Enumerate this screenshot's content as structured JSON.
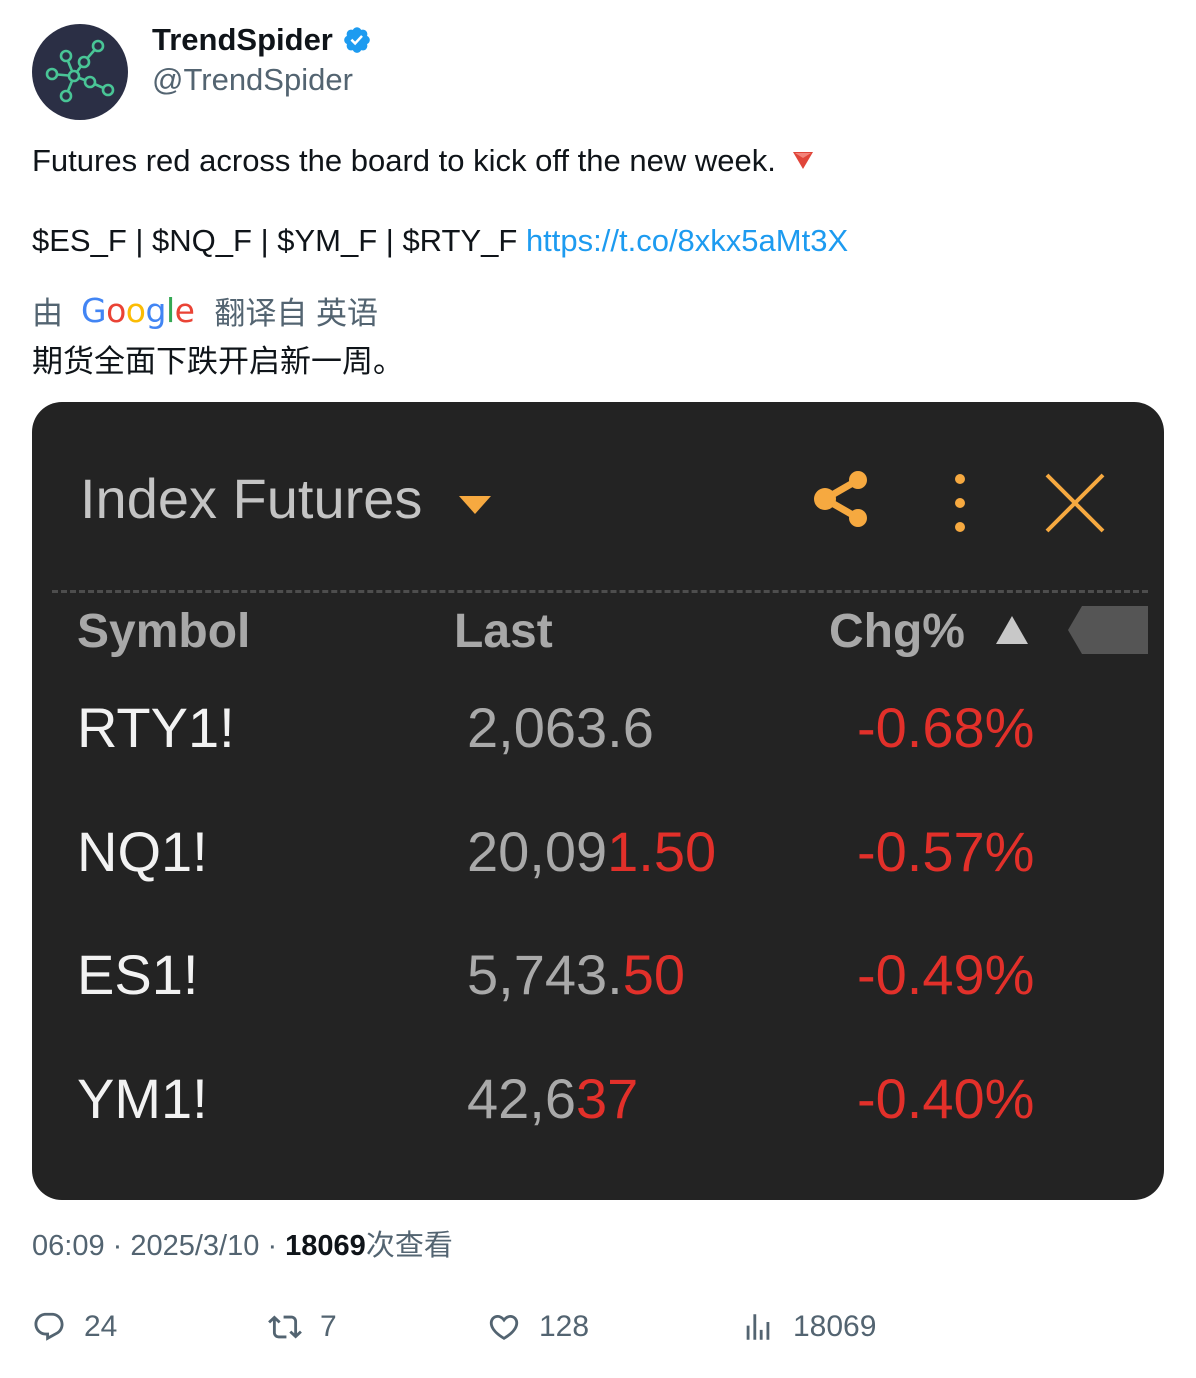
{
  "author": {
    "display_name": "TrendSpider",
    "handle": "@TrendSpider",
    "verified": true,
    "avatar_icon": "trendspider-logo-icon"
  },
  "tweet": {
    "text_line1": "Futures red across the board to kick off the new week.",
    "emoji": "red-triangle-down",
    "cashtags": "$ES_F | $NQ_F | $YM_F | $RTY_F",
    "link": "https://t.co/8xkx5aMt3X",
    "translate": {
      "by": "由",
      "google": [
        "G",
        "o",
        "o",
        "g",
        "l",
        "e"
      ],
      "from": "翻译自 英语"
    },
    "translation": "期货全面下跌开启新一周。"
  },
  "widget": {
    "title": "Index Futures",
    "columns": {
      "symbol": "Symbol",
      "last": "Last",
      "chg": "Chg%"
    },
    "rows": [
      {
        "symbol": "RTY1!",
        "last_plain": "2,063.6",
        "last_red": "",
        "chg": "-0.68%"
      },
      {
        "symbol": "NQ1!",
        "last_plain": "20,09",
        "last_red": "1.50",
        "chg": "-0.57%"
      },
      {
        "symbol": "ES1!",
        "last_plain": "5,743.",
        "last_red": "50",
        "chg": "-0.49%"
      },
      {
        "symbol": "YM1!",
        "last_plain": "42,6",
        "last_red": "37",
        "chg": "-0.40%"
      }
    ],
    "colors": {
      "background": "#232323",
      "accent": "#f6a940",
      "negative": "#e2302a"
    }
  },
  "meta": {
    "time": "06:09",
    "date": "2025/3/10",
    "views": "18069",
    "views_label": "次查看"
  },
  "actions": {
    "replies": "24",
    "retweets": "7",
    "likes": "128",
    "views": "18069"
  }
}
